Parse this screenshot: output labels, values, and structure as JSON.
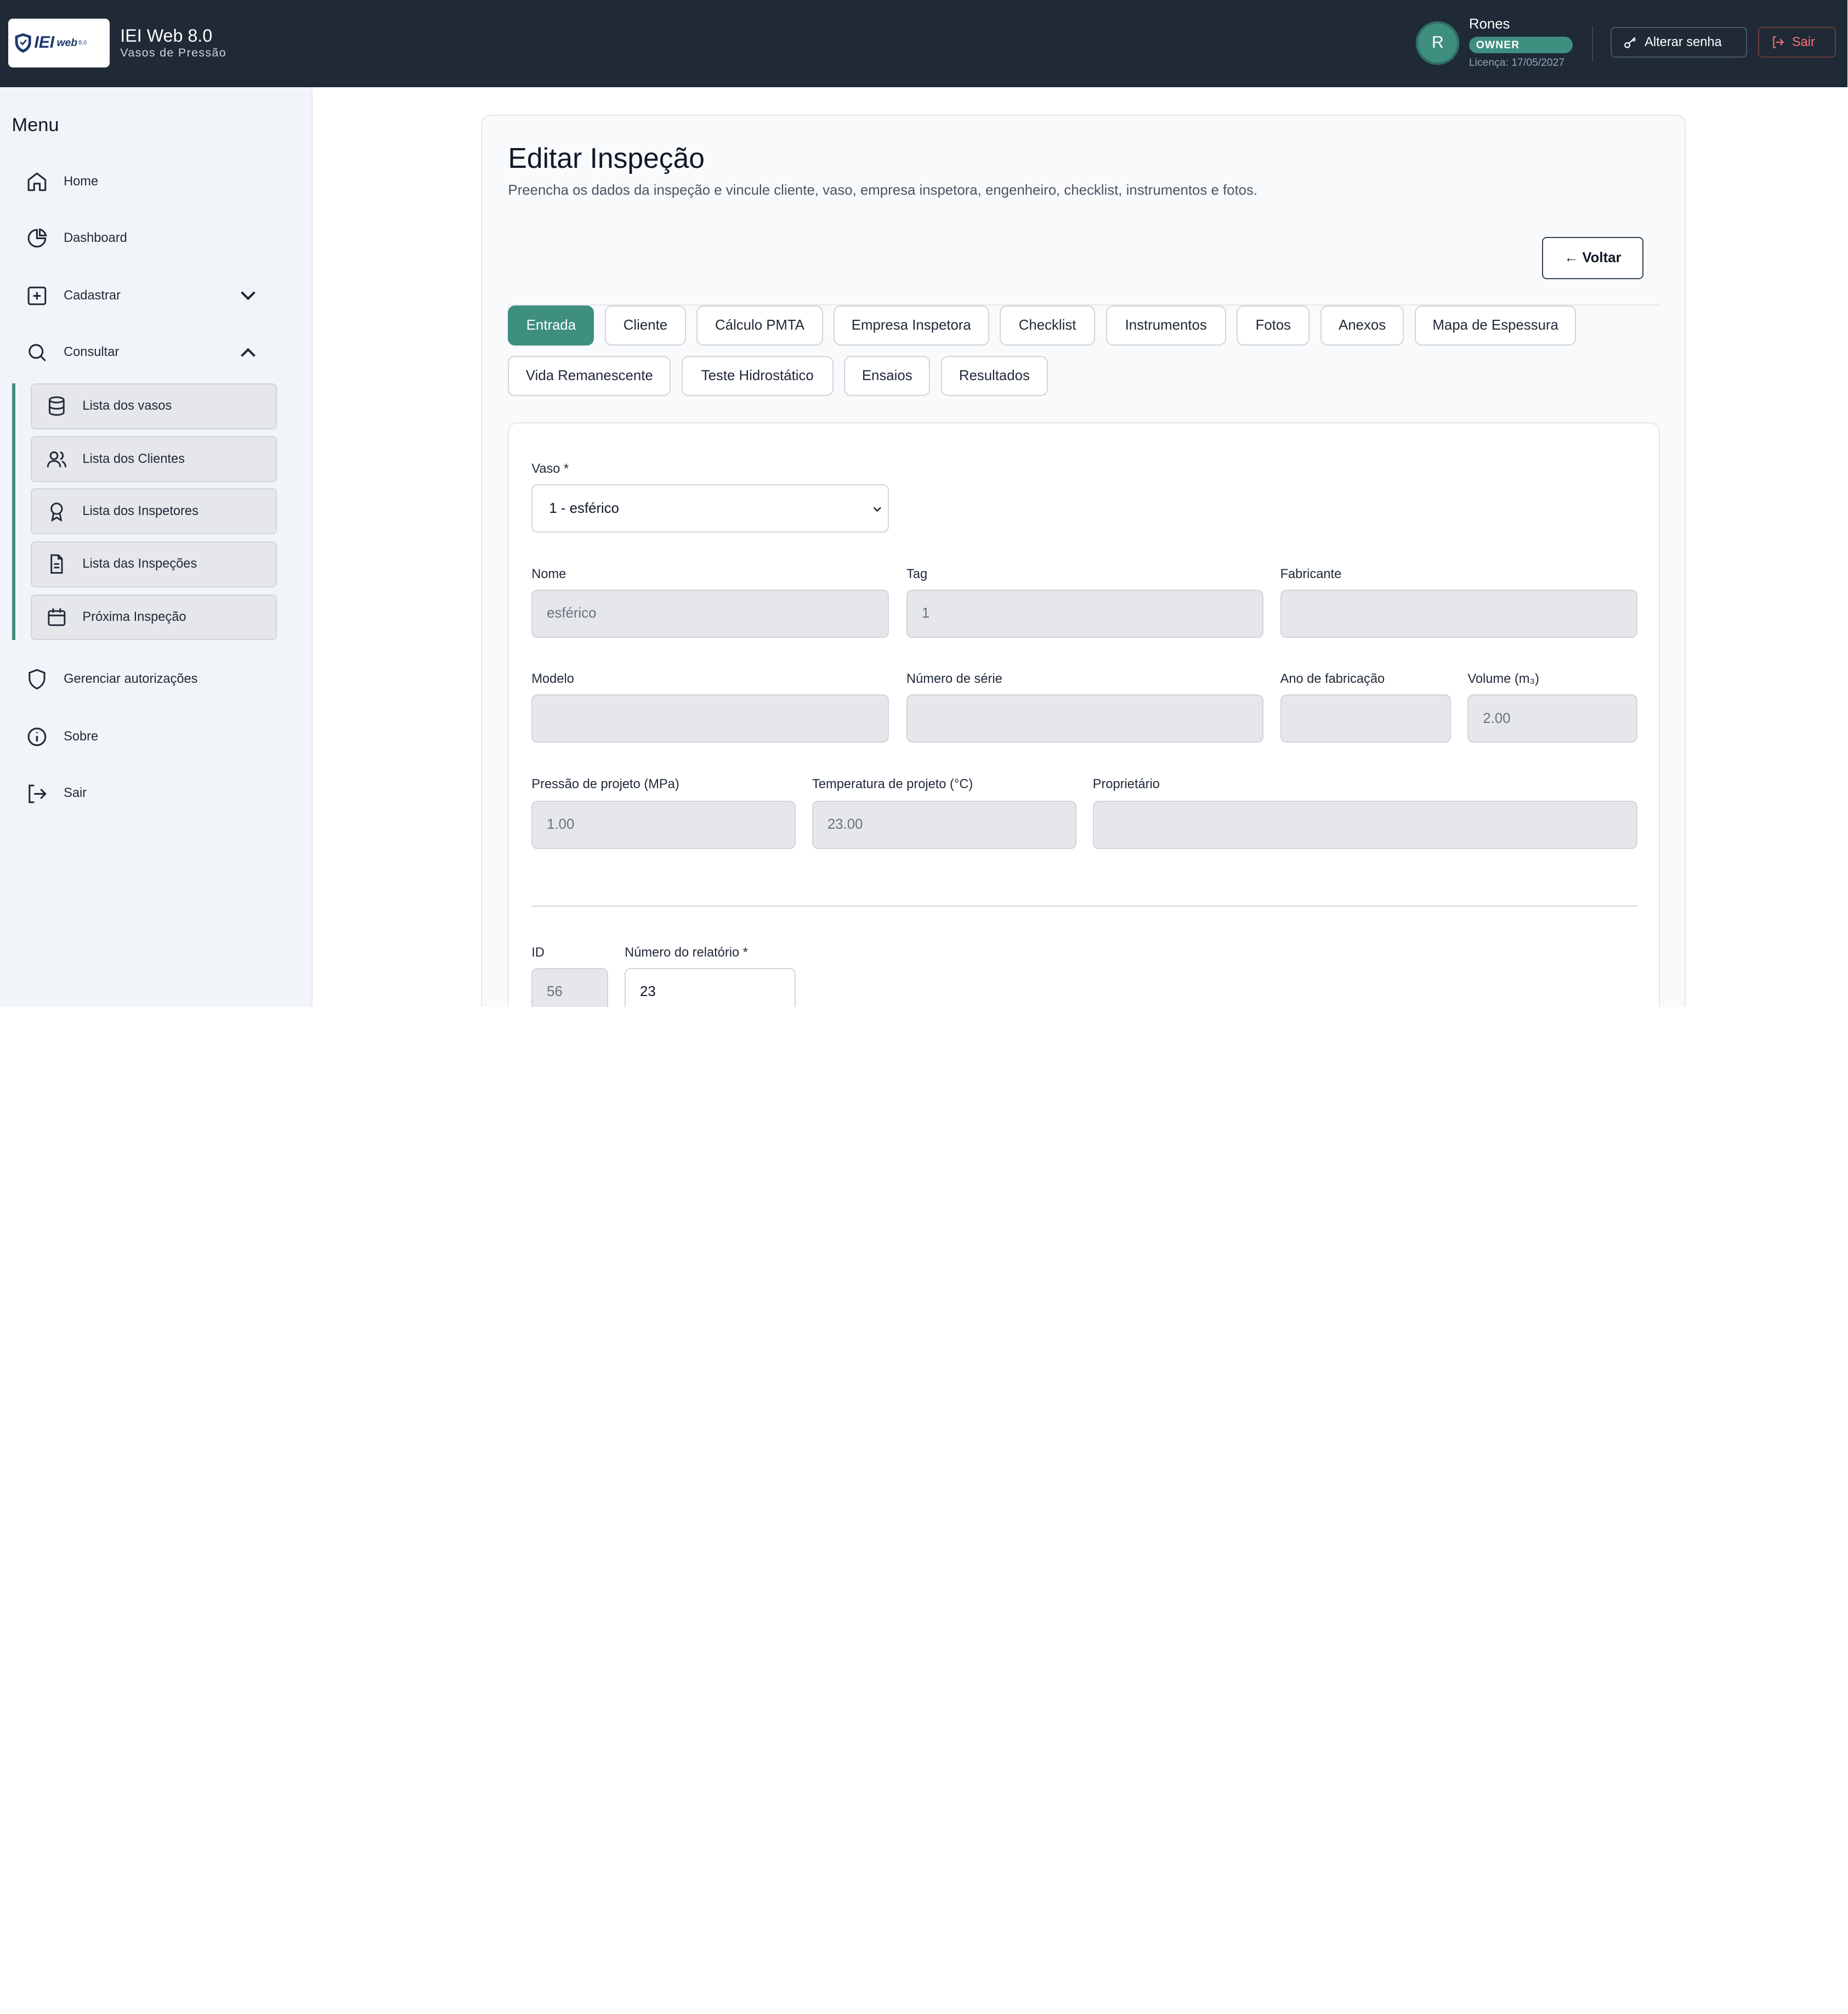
{
  "header": {
    "logo_text": "IEI",
    "logo_web": "web",
    "logo_version": "8.0",
    "app_title": "IEI Web 8.0",
    "app_subtitle": "Vasos de Pressão",
    "avatar_initial": "R",
    "user_name": "Rones",
    "role_badge": "OWNER",
    "license": "Licença: 17/05/2027",
    "change_password": "Alterar senha",
    "logout": "Sair"
  },
  "sidebar": {
    "title": "Menu",
    "items": [
      {
        "label": "Home",
        "icon": "home-icon"
      },
      {
        "label": "Dashboard",
        "icon": "pie-chart-icon"
      },
      {
        "label": "Cadastrar",
        "icon": "plus-square-icon"
      },
      {
        "label": "Consultar",
        "icon": "search-icon"
      }
    ],
    "sub_items": [
      {
        "label": "Lista dos vasos",
        "icon": "database-icon"
      },
      {
        "label": "Lista dos Clientes",
        "icon": "users-icon"
      },
      {
        "label": "Lista dos Inspetores",
        "icon": "award-icon"
      },
      {
        "label": "Lista das Inspeções",
        "icon": "file-text-icon"
      },
      {
        "label": "Próxima Inspeção",
        "icon": "calendar-icon"
      }
    ],
    "bottom_items": [
      {
        "label": "Gerenciar autorizações",
        "icon": "shield-icon"
      },
      {
        "label": "Sobre",
        "icon": "info-icon"
      },
      {
        "label": "Sair",
        "icon": "logout-icon"
      }
    ]
  },
  "main": {
    "title": "Editar Inspeção",
    "subtitle": "Preencha os dados da inspeção e vincule cliente, vaso, empresa inspetora, engenheiro, checklist, instrumentos e fotos.",
    "back_button": "← Voltar",
    "tabs": [
      "Entrada",
      "Cliente",
      "Cálculo PMTA",
      "Empresa Inspetora",
      "Checklist",
      "Instrumentos",
      "Fotos",
      "Anexos",
      "Mapa de Espessura",
      "Vida Remanescente",
      "Teste Hidrostático",
      "Ensaios",
      "Resultados"
    ],
    "active_tab": "Entrada",
    "form": {
      "vaso_label": "Vaso *",
      "vaso_value": "1 - esférico",
      "nome_label": "Nome",
      "nome_value": "esférico",
      "tag_label": "Tag",
      "tag_value": "1",
      "fabricante_label": "Fabricante",
      "fabricante_value": "",
      "modelo_label": "Modelo",
      "modelo_value": "",
      "serie_label": "Número de série",
      "serie_value": "",
      "ano_label": "Ano de fabricação",
      "ano_value": "",
      "volume_label": "Volume (m₃)",
      "volume_value": "2.00",
      "pressao_label": "Pressão de projeto (MPa)",
      "pressao_value": "1.00",
      "temperatura_label": "Temperatura de projeto (°C)",
      "temperatura_value": "23.00",
      "proprietario_label": "Proprietário",
      "proprietario_value": "",
      "id_label": "ID",
      "id_value": "56",
      "relatorio_label": "Número do relatório *",
      "relatorio_value": "23"
    }
  },
  "colors": {
    "topbar": "#1f2a36",
    "accent": "#3f8f80",
    "sidebar_bg": "#f1f5f9",
    "danger": "#f87171"
  }
}
